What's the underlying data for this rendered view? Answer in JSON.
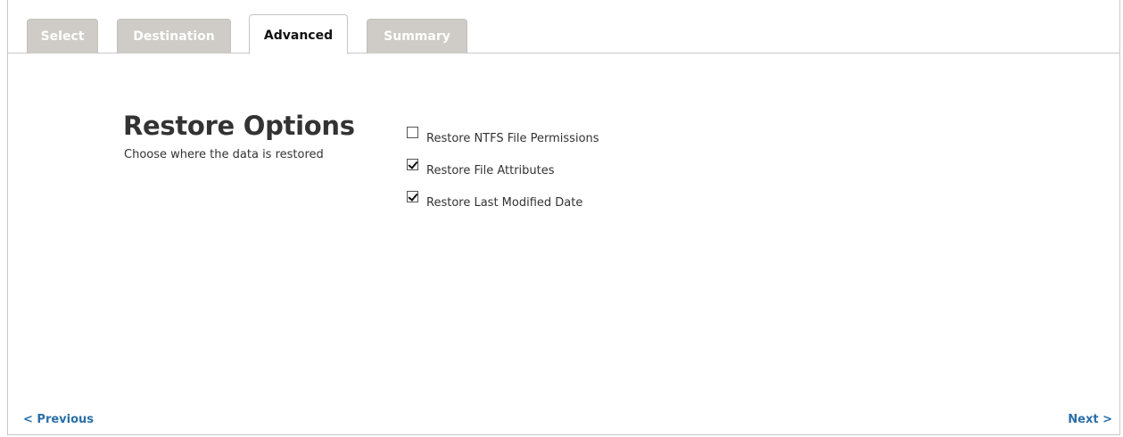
{
  "tabs": [
    {
      "label": "Select",
      "active": false
    },
    {
      "label": "Destination",
      "active": false
    },
    {
      "label": "Advanced",
      "active": true
    },
    {
      "label": "Summary",
      "active": false
    }
  ],
  "section": {
    "title": "Restore Options",
    "subtitle": "Choose where the data is restored"
  },
  "options": [
    {
      "label": "Restore NTFS File Permissions",
      "checked": false
    },
    {
      "label": "Restore File Attributes",
      "checked": true
    },
    {
      "label": "Restore Last Modified Date",
      "checked": true
    }
  ],
  "nav": {
    "previous": "< Previous",
    "next": "Next >"
  },
  "colors": {
    "inactive_tab_bg": "#cfcbc6",
    "link": "#2a6fa8",
    "text": "#333333"
  }
}
